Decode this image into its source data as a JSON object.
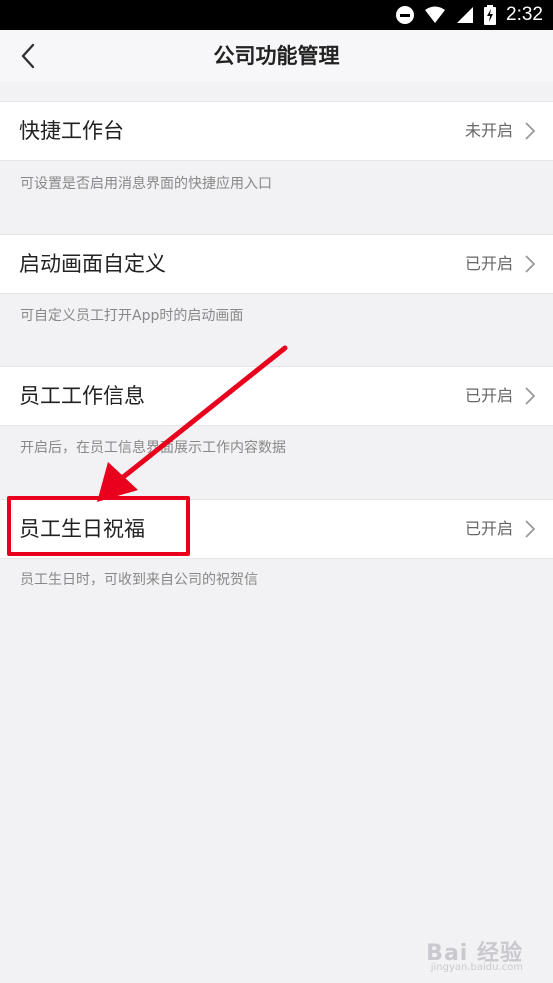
{
  "status_bar": {
    "time": "2:32",
    "icons": [
      "do-not-disturb-icon",
      "wifi-icon",
      "signal-icon",
      "battery-charging-icon"
    ]
  },
  "header": {
    "title": "公司功能管理",
    "back_icon": "chevron-left-icon"
  },
  "settings": [
    {
      "label": "快捷工作台",
      "status": "未开启",
      "description": "可设置是否启用消息界面的快捷应用入口"
    },
    {
      "label": "启动画面自定义",
      "status": "已开启",
      "description": "可自定义员工打开App时的启动画面"
    },
    {
      "label": "员工工作信息",
      "status": "已开启",
      "description": "开启后，在员工信息界面展示工作内容数据"
    },
    {
      "label": "员工生日祝福",
      "status": "已开启",
      "description": "员工生日时，可收到来自公司的祝贺信"
    }
  ],
  "colors": {
    "accent_red": "#e8001c",
    "background": "#f2f2f4"
  },
  "watermark": {
    "text": "Bai 经验",
    "sub": "jingyan.baidu.com"
  }
}
